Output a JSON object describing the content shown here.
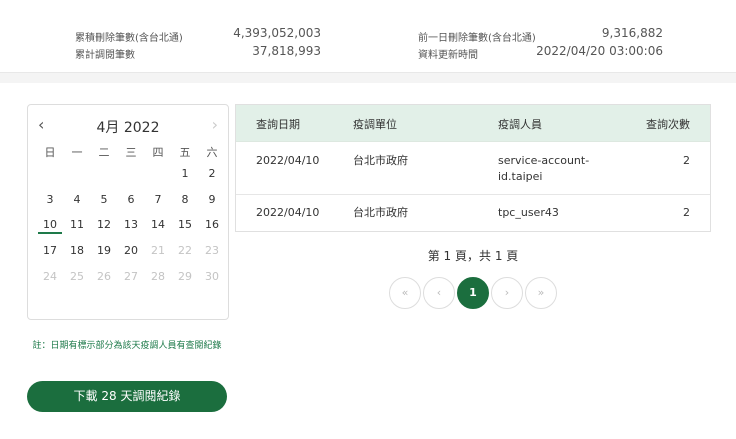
{
  "stats": {
    "cumulative_deleted_label": "累積刪除筆數(含台北通)",
    "cumulative_deleted_value": "4,393,052,003",
    "cumulative_viewed_label": "累計調閱筆數",
    "cumulative_viewed_value": "37,818,993",
    "prev_day_deleted_label": "前一日刪除筆數(含台北通)",
    "prev_day_deleted_value": "9,316,882",
    "data_updated_label": "資料更新時間",
    "data_updated_value": "2022/04/20 03:00:06"
  },
  "calendar": {
    "title": "4月 2022",
    "prev_icon": "‹",
    "next_icon": "›",
    "weekdays": [
      "日",
      "一",
      "二",
      "三",
      "四",
      "五",
      "六"
    ],
    "weeks": [
      [
        "",
        "",
        "",
        "",
        "",
        "1",
        "2"
      ],
      [
        "3",
        "4",
        "5",
        "6",
        "7",
        "8",
        "9"
      ],
      [
        "10",
        "11",
        "12",
        "13",
        "14",
        "15",
        "16"
      ],
      [
        "17",
        "18",
        "19",
        "20",
        "21",
        "22",
        "23"
      ],
      [
        "24",
        "25",
        "26",
        "27",
        "28",
        "29",
        "30"
      ]
    ],
    "selected_day": "10",
    "first_disabled_day": 21
  },
  "note": "註：日期有標示部分為該天疫調人員有查閱紀錄",
  "download_button": "下載 28 天調閱紀錄",
  "table": {
    "headers": [
      "查詢日期",
      "疫調單位",
      "疫調人員",
      "查詢次數"
    ],
    "rows": [
      {
        "date": "2022/04/10",
        "unit": "台北市政府",
        "user_line1": "service-account-",
        "user_line2": "id.taipei",
        "count": "2"
      },
      {
        "date": "2022/04/10",
        "unit": "台北市政府",
        "user_line1": "tpc_user43",
        "user_line2": "",
        "count": "2"
      }
    ]
  },
  "pagination": {
    "info": "第 1 頁，共 1 頁",
    "first": "«",
    "prev": "‹",
    "current": "1",
    "next": "›",
    "last": "»"
  },
  "colors": {
    "accent": "#1b6e3e",
    "table_header": "#e2f0e8"
  }
}
